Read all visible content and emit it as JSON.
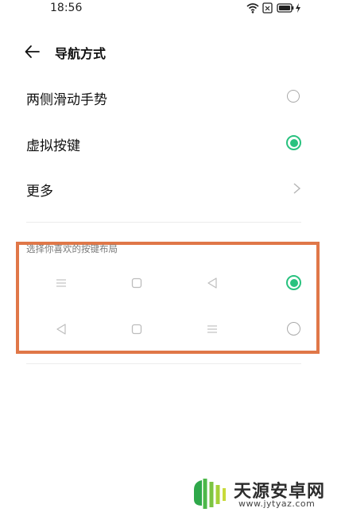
{
  "status_bar": {
    "time": "18:56",
    "icons": [
      "wifi-icon",
      "sim-icon",
      "battery-icon",
      "charging-icon"
    ]
  },
  "header": {
    "title": "导航方式",
    "back_icon": "back-arrow-icon"
  },
  "options": [
    {
      "label": "两侧滑动手势",
      "selected": false
    },
    {
      "label": "虚拟按键",
      "selected": true
    },
    {
      "label": "更多",
      "type": "link"
    }
  ],
  "layouts": {
    "label": "选择你喜欢的按键布局",
    "rows": [
      {
        "buttons": [
          "menu-icon",
          "home-square-icon",
          "back-triangle-icon"
        ],
        "selected": true
      },
      {
        "buttons": [
          "back-triangle-icon",
          "home-square-icon",
          "menu-icon"
        ],
        "selected": false
      }
    ]
  },
  "colors": {
    "accent": "#29c27f",
    "highlight_border": "#e07748"
  },
  "watermark": {
    "name": "天源安卓网",
    "url": "www.jytyaz.com"
  }
}
